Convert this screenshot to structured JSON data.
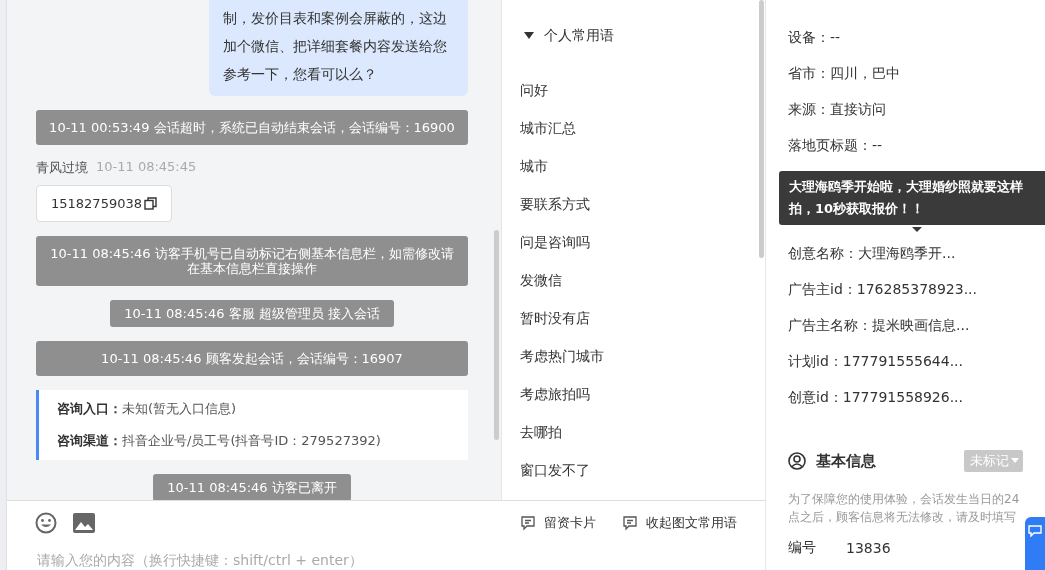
{
  "chat": {
    "messages": [
      {
        "kind": "agent",
        "text": "制，发价目表和案例会屏蔽的，这边加个微信、把详细套餐内容发送给您参考一下，您看可以么？"
      },
      {
        "kind": "system",
        "text": "10-11 00:53:49 会话超时，系统已自动结束会话，会话编号：16900"
      },
      {
        "kind": "visitor",
        "name": "青风过境",
        "time": "10-11 08:45:45",
        "text": "15182759038"
      },
      {
        "kind": "system",
        "text": "10-11 08:45:46 访客手机号已自动标记右侧基本信息栏，如需修改请在基本信息栏直接操作"
      },
      {
        "kind": "system",
        "text": "10-11 08:45:46 客服 超级管理员 接入会话"
      },
      {
        "kind": "system",
        "text": "10-11 08:45:46 顾客发起会话，会话编号：16907"
      },
      {
        "kind": "info",
        "lines": [
          {
            "label": "咨询入口：",
            "value": "未知(暂无入口信息)"
          },
          {
            "label": "咨询渠道：",
            "value": "抖音企业号/员工号(抖音号ID：279527392)"
          }
        ]
      },
      {
        "kind": "system",
        "text": "10-11 08:45:46 访客已离开"
      }
    ]
  },
  "input": {
    "placeholder": "请输入您的内容（换行快捷键：shift/ctrl + enter）",
    "actions": [
      "留资卡片",
      "收起图文常用语"
    ]
  },
  "phrases": {
    "group": "个人常用语",
    "expanded": true,
    "items": [
      "问好",
      "城市汇总",
      "城市",
      "要联系方式",
      "问是咨询吗",
      "发微信",
      "暂时没有店",
      "考虑热门城市",
      "考虑旅拍吗",
      "去哪拍",
      "窗口发不了"
    ]
  },
  "source_info": {
    "rows": [
      {
        "label": "设备：",
        "value": "--"
      },
      {
        "label": "省市：",
        "value": "四川，巴中"
      },
      {
        "label": "来源：",
        "value": "直接访问"
      },
      {
        "label": "落地页标题：",
        "value": "--"
      }
    ],
    "tooltip": "大理海鸥季开始啦，大理婚纱照就要这样拍，10秒获取报价！！",
    "rows_below": [
      {
        "label": "创意名称：",
        "value": "大理海鸥季开..."
      },
      {
        "label": "广告主id：",
        "value": "176285378923..."
      },
      {
        "label": "广告主名称：",
        "value": "提米映画信息..."
      },
      {
        "label": "计划id：",
        "value": "177791555644..."
      },
      {
        "label": "创意id：",
        "value": "177791558926..."
      }
    ]
  },
  "basic_info": {
    "title": "基本信息",
    "tag": "未标记",
    "note": "为了保障您的使用体验，会话发生当日的24点之后，顾客信息将无法修改，请及时填写",
    "rows": [
      {
        "label": "编号",
        "value": "13836"
      }
    ]
  }
}
